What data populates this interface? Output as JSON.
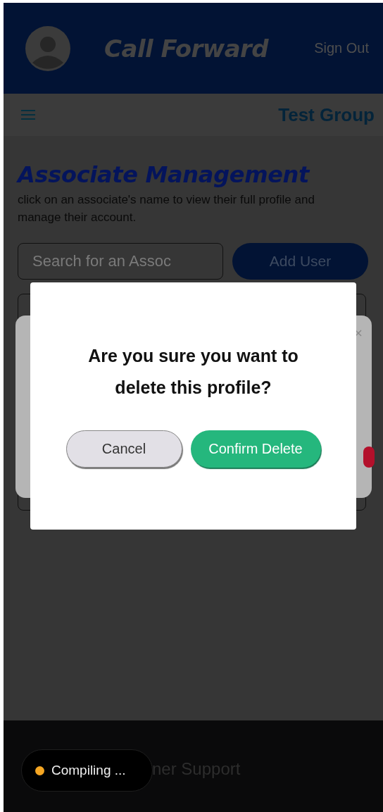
{
  "header": {
    "app_title": "Call Forward",
    "sign_out": "Sign Out"
  },
  "subheader": {
    "group": "Test Group"
  },
  "page": {
    "title": "Associate Management",
    "description": "click on an associate's name to view their full profile and manage their account.",
    "search": {
      "placeholder": "Search for an Assoc"
    },
    "add_button": "Add User"
  },
  "dialog": {
    "message": "Are you sure you want to delete this profile?",
    "buttons": [
      {
        "label": "Cancel",
        "kind": "secondary"
      },
      {
        "label": "Confirm Delete",
        "kind": "primary"
      }
    ]
  },
  "footer": {
    "text": "ner Support"
  },
  "build_indicator": {
    "label": "Compiling ..."
  }
}
